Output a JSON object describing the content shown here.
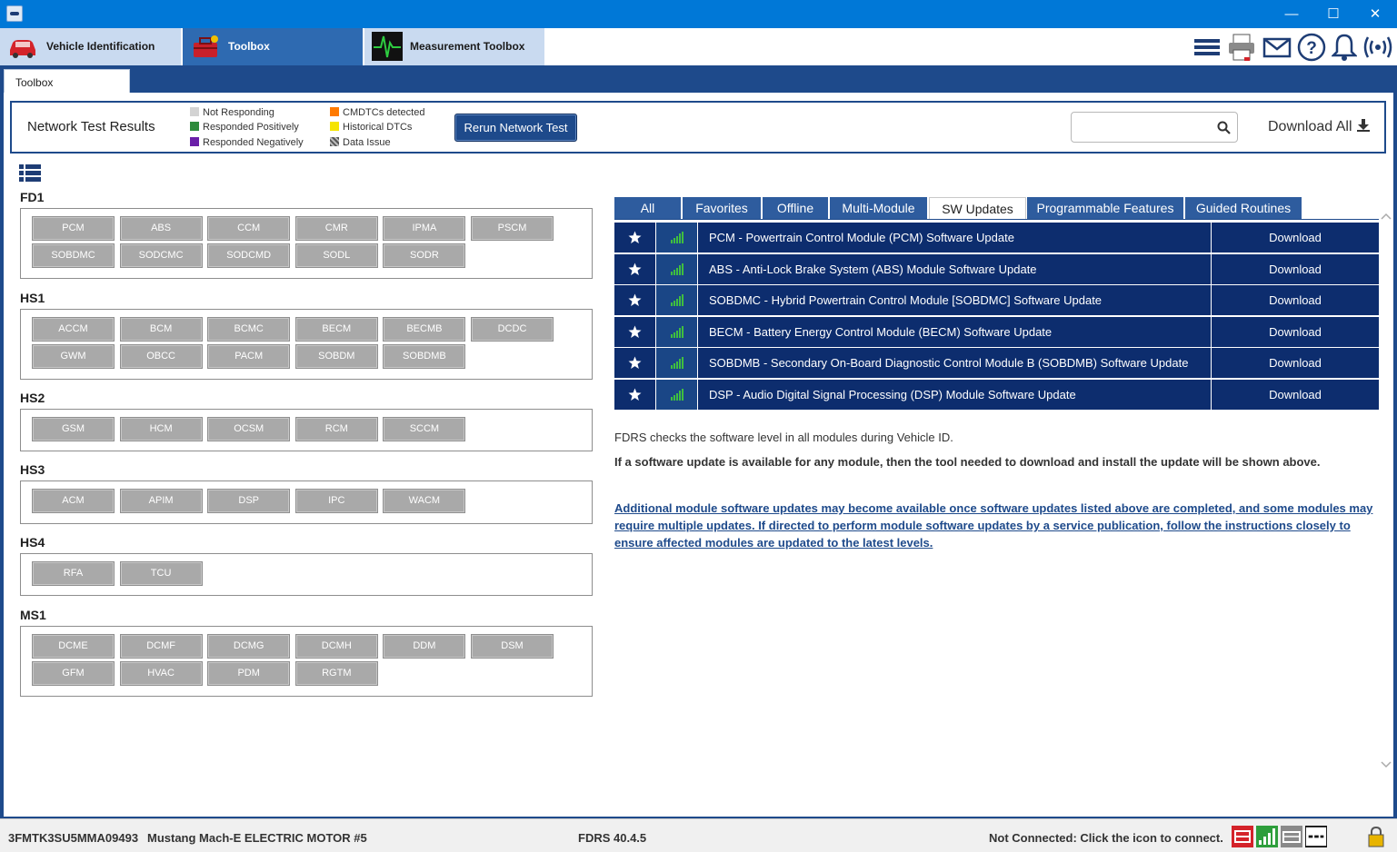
{
  "window": {
    "minimize": "—",
    "maximize": "☐",
    "close": "✕"
  },
  "nav": {
    "tabs": [
      {
        "label": "Vehicle Identification",
        "icon": "car-icon"
      },
      {
        "label": "Toolbox",
        "icon": "toolbox-icon"
      },
      {
        "label": "Measurement Toolbox",
        "icon": "waveform-icon"
      }
    ],
    "tools": [
      "menu-icon",
      "printer-icon",
      "mail-icon",
      "help-icon",
      "bell-icon",
      "wireless-icon"
    ]
  },
  "subtab": {
    "label": "Toolbox"
  },
  "network": {
    "title": "Network Test Results",
    "legend": [
      {
        "label": "Not Responding",
        "color": "#d3d3d3"
      },
      {
        "label": "Responded Positively",
        "color": "#2e8b3c"
      },
      {
        "label": "Responded Negatively",
        "color": "#6a1fa8"
      },
      {
        "label": "CMDTCs detected",
        "color": "#ff7a00"
      },
      {
        "label": "Historical DTCs",
        "color": "#f5e400"
      },
      {
        "label": "Data Issue",
        "color": "#777777"
      }
    ],
    "rerun_label": "Rerun Network Test",
    "search_placeholder": "",
    "download_all": "Download All"
  },
  "groups": [
    {
      "name": "FD1",
      "modules": [
        "PCM",
        "ABS",
        "CCM",
        "CMR",
        "IPMA",
        "PSCM",
        "SOBDMC",
        "SODCMC",
        "SODCMD",
        "SODL",
        "SODR"
      ]
    },
    {
      "name": "HS1",
      "modules": [
        "ACCM",
        "BCM",
        "BCMC",
        "BECM",
        "BECMB",
        "DCDC",
        "GWM",
        "OBCC",
        "PACM",
        "SOBDM",
        "SOBDMB"
      ]
    },
    {
      "name": "HS2",
      "modules": [
        "GSM",
        "HCM",
        "OCSM",
        "RCM",
        "SCCM"
      ]
    },
    {
      "name": "HS3",
      "modules": [
        "ACM",
        "APIM",
        "DSP",
        "IPC",
        "WACM"
      ]
    },
    {
      "name": "HS4",
      "modules": [
        "RFA",
        "TCU"
      ]
    },
    {
      "name": "MS1",
      "modules": [
        "DCME",
        "DCMF",
        "DCMG",
        "DCMH",
        "DDM",
        "DSM",
        "GFM",
        "HVAC",
        "PDM",
        "RGTM"
      ]
    }
  ],
  "right_tabs": [
    "All",
    "Favorites",
    "Offline",
    "Multi-Module",
    "SW Updates",
    "Programmable Features",
    "Guided Routines"
  ],
  "active_right_tab": "SW Updates",
  "updates": [
    {
      "name": "PCM - Powertrain Control Module (PCM) Software Update",
      "action": "Download"
    },
    {
      "name": "ABS - Anti-Lock Brake System (ABS) Module Software Update",
      "action": "Download"
    },
    {
      "name": "SOBDMC - Hybrid Powertrain Control Module [SOBDMC] Software Update",
      "action": "Download"
    },
    {
      "name": "BECM - Battery Energy Control Module (BECM) Software Update",
      "action": "Download"
    },
    {
      "name": "SOBDMB - Secondary On-Board Diagnostic Control Module B (SOBDMB) Software Update",
      "action": "Download"
    },
    {
      "name": "DSP - Audio Digital Signal Processing (DSP) Module Software Update",
      "action": "Download"
    }
  ],
  "info": {
    "line1": "FDRS checks the software level in all modules during Vehicle ID.",
    "line2": "If a software update is available for any module, then the tool needed to download and install the update will be shown above.",
    "line3": "Additional module software updates may become available once software updates listed above are completed, and some modules may require multiple updates. If directed to perform module software updates by a service publication, follow the instructions closely to ensure affected modules are updated to the latest levels."
  },
  "status": {
    "vin": "3FMTK3SU5MMA09493",
    "vehicle": "Mustang Mach-E ELECTRIC MOTOR #5",
    "version": "FDRS 40.4.5",
    "connection": "Not Connected: Click the icon to connect.",
    "colors": {
      "brand": "#1e4a8b",
      "accent": "#2e6ab1",
      "row": "#0d2d6e"
    }
  }
}
